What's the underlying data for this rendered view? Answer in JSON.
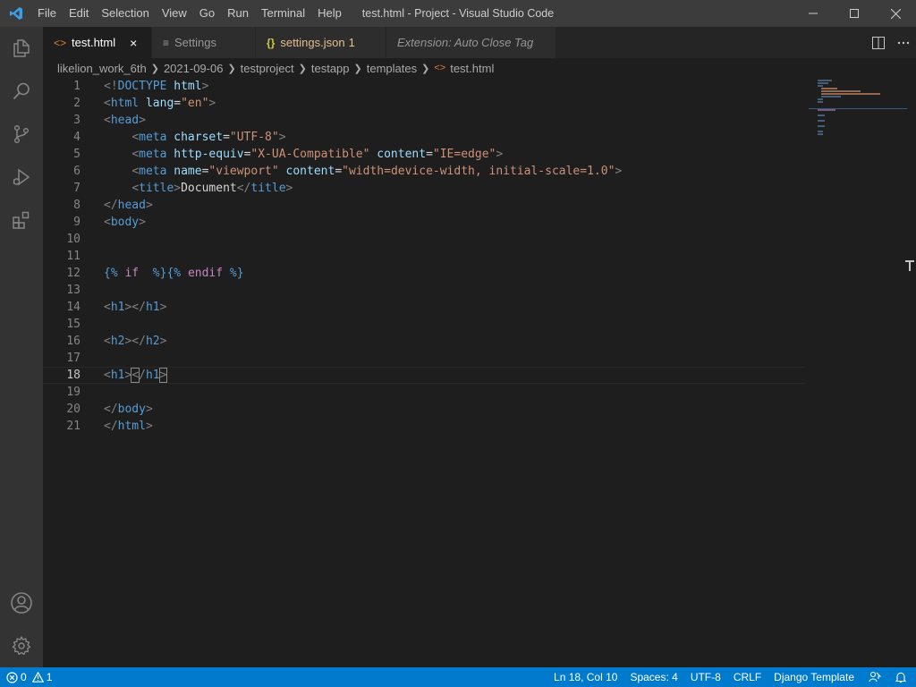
{
  "titlebar": {
    "menu": [
      "File",
      "Edit",
      "Selection",
      "View",
      "Go",
      "Run",
      "Terminal",
      "Help"
    ],
    "window_title": "test.html - Project - Visual Studio Code"
  },
  "tabs": [
    {
      "label": "test.html",
      "icon": "<>",
      "active": true,
      "close": "×"
    },
    {
      "label": "Settings",
      "icon": "≡"
    },
    {
      "label": "settings.json",
      "icon": "{}",
      "badge": "1"
    },
    {
      "label": "Extension: Auto Close Tag"
    }
  ],
  "breadcrumb": [
    "likelion_work_6th",
    "2021-09-06",
    "testproject",
    "testapp",
    "templates",
    "test.html"
  ],
  "editor": {
    "line_numbers": [
      "1",
      "2",
      "3",
      "4",
      "5",
      "6",
      "7",
      "8",
      "9",
      "10",
      "11",
      "12",
      "13",
      "14",
      "15",
      "16",
      "17",
      "18",
      "19",
      "20",
      "21"
    ],
    "current_line": 18
  },
  "statusbar": {
    "errors": "0",
    "warnings": "1",
    "position": "Ln 18, Col 10",
    "spaces": "Spaces: 4",
    "encoding": "UTF-8",
    "eol": "CRLF",
    "language": "Django Template"
  },
  "colors": {
    "accent": "#007acc",
    "tag": "#569cd6",
    "attribute": "#9cdcfe",
    "string": "#ce9178",
    "keyword": "#c586c0",
    "json_tab": "#e2c08d"
  }
}
